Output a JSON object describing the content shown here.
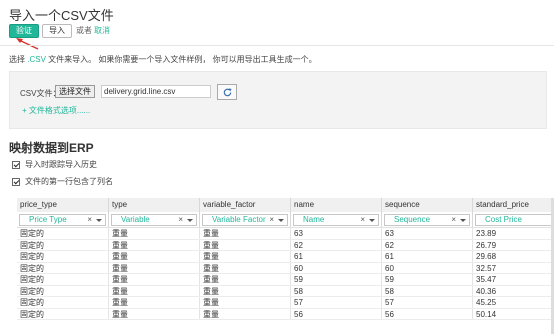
{
  "header": {
    "title": "导入一个CSV文件",
    "validate_label": "验证",
    "import_label": "导入",
    "or_text": "或者",
    "cancel_label": "取消"
  },
  "intro": {
    "prefix": "选择",
    "csv_link": ".CSV",
    "middle": "文件来导入。 如果你需要一个导入文件样例， 你可以用导出工具生成一个。"
  },
  "file_panel": {
    "csv_label": "CSV文件：",
    "choose_label": "选择文件",
    "filename": "delivery.grid.line.csv",
    "format_options_label": "+ 文件格式选项......"
  },
  "mapping": {
    "title": "映射数据到ERP",
    "track_history_label": "导入时跟踪导入历史",
    "first_row_header_label": "文件的第一行包含了列名"
  },
  "table": {
    "headers": [
      "price_type",
      "type",
      "variable_factor",
      "name",
      "sequence",
      "standard_price"
    ],
    "field_selects": [
      "Price Type",
      "Variable",
      "Variable Factor",
      "Name",
      "Sequence",
      "Cost Price"
    ],
    "rows": [
      [
        "固定的",
        "重量",
        "重量",
        "63",
        "63",
        "23.89"
      ],
      [
        "固定的",
        "重量",
        "重量",
        "62",
        "62",
        "26.79"
      ],
      [
        "固定的",
        "重量",
        "重量",
        "61",
        "61",
        "29.68"
      ],
      [
        "固定的",
        "重量",
        "重量",
        "60",
        "60",
        "32.57"
      ],
      [
        "固定的",
        "重量",
        "重量",
        "59",
        "59",
        "35.47"
      ],
      [
        "固定的",
        "重量",
        "重量",
        "58",
        "58",
        "40.36"
      ],
      [
        "固定的",
        "重量",
        "重量",
        "57",
        "57",
        "45.25"
      ],
      [
        "固定的",
        "重量",
        "重量",
        "56",
        "56",
        "50.14"
      ]
    ]
  },
  "colors": {
    "accent": "#21b799",
    "arrow": "#d9302b"
  }
}
